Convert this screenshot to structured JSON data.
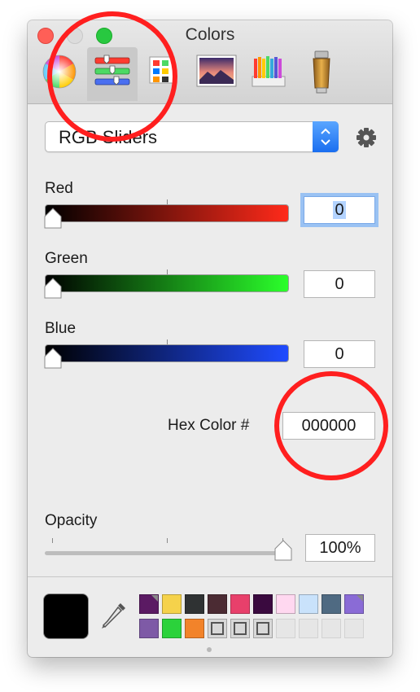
{
  "window": {
    "title": "Colors"
  },
  "toolbar": {
    "items": [
      {
        "name": "Color Wheel",
        "icon": "color-wheel-icon"
      },
      {
        "name": "Color Sliders",
        "icon": "sliders-icon",
        "selected": true
      },
      {
        "name": "Color Palettes",
        "icon": "palettes-icon"
      },
      {
        "name": "Image Palettes",
        "icon": "image-palette-icon"
      },
      {
        "name": "Pencils",
        "icon": "pencils-icon"
      },
      {
        "name": "Paint Tube",
        "icon": "paint-tube-icon"
      }
    ]
  },
  "slider_mode": {
    "selected": "RGB Sliders"
  },
  "sliders": {
    "red": {
      "label": "Red",
      "value": "0",
      "level": 0,
      "color": "#ff2a1a"
    },
    "green": {
      "label": "Green",
      "value": "0",
      "level": 0,
      "color": "#2bff2b"
    },
    "blue": {
      "label": "Blue",
      "value": "0",
      "level": 0,
      "color": "#1f4bff"
    }
  },
  "hex": {
    "label": "Hex Color #",
    "value": "000000"
  },
  "opacity": {
    "label": "Opacity",
    "value": "100%",
    "level": 1.0
  },
  "current_color": "#000000",
  "swatches": [
    {
      "color": "#5b1a63",
      "flag": true
    },
    {
      "color": "#f5d24b"
    },
    {
      "color": "#2f3233"
    },
    {
      "color": "#4b2b33"
    },
    {
      "color": "#e8406b"
    },
    {
      "color": "#3a0a3f"
    },
    {
      "color": "#ffd8f0"
    },
    {
      "color": "#c9e2fb"
    },
    {
      "color": "#4f6a82"
    },
    {
      "color": "#8a6bd6",
      "flag": true
    },
    {
      "color": "#7e5aa6"
    },
    {
      "color": "#2bd23b"
    },
    {
      "color": "#f2832a"
    },
    {
      "color": "",
      "outlined": true
    },
    {
      "color": "",
      "outlined": true
    },
    {
      "color": "",
      "outlined": true
    },
    {
      "color": "",
      "empty": true
    },
    {
      "color": "",
      "empty": true
    },
    {
      "color": "",
      "empty": true
    },
    {
      "color": "",
      "empty": true
    }
  ]
}
